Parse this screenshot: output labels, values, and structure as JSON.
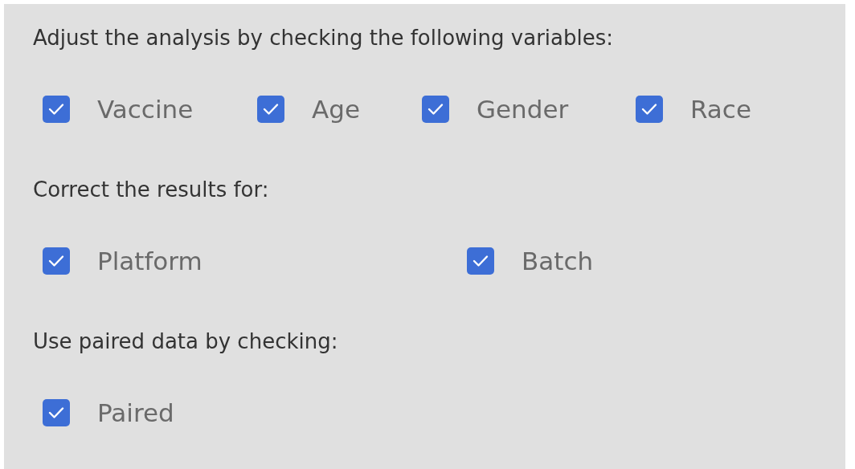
{
  "sections": [
    {
      "heading": "Adjust the analysis by checking the following variables:",
      "options": [
        {
          "label": "Vaccine",
          "checked": true
        },
        {
          "label": "Age",
          "checked": true
        },
        {
          "label": "Gender",
          "checked": true
        },
        {
          "label": "Race",
          "checked": true
        }
      ]
    },
    {
      "heading": "Correct the results for:",
      "options": [
        {
          "label": "Platform",
          "checked": true
        },
        {
          "label": "Batch",
          "checked": true
        }
      ]
    },
    {
      "heading": "Use paired data by checking:",
      "options": [
        {
          "label": "Paired",
          "checked": true
        }
      ]
    }
  ]
}
